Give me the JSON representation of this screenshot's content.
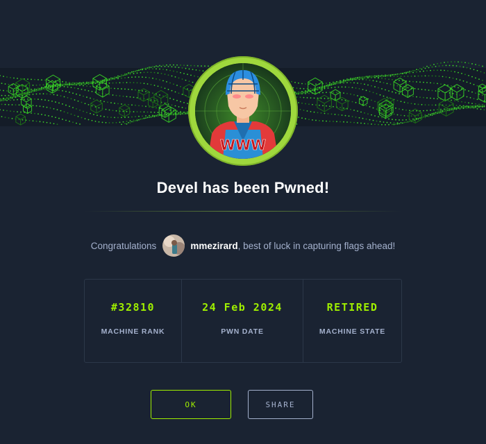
{
  "machine": {
    "name": "Devel",
    "pwned_title": "Devel has been Pwned!",
    "avatar_text": "WWW"
  },
  "message": {
    "prefix": "Congratulations",
    "username": "mmezirard",
    "suffix": ", best of luck in capturing flags ahead!"
  },
  "stats": [
    {
      "value": "#32810",
      "label": "MACHINE RANK"
    },
    {
      "value": "24 Feb 2024",
      "label": "PWN DATE"
    },
    {
      "value": "RETIRED",
      "label": "MACHINE STATE"
    }
  ],
  "buttons": {
    "ok_label": "OK",
    "share_label": "SHARE"
  },
  "colors": {
    "background": "#1a2332",
    "accent": "#9fef00",
    "ring": "#9fd83d",
    "muted_text": "#a4b1cd",
    "border": "#2c3849"
  },
  "icons": {
    "machine_avatar": "devel-machine-avatar",
    "user_avatar": "user-avatar",
    "banner": "green-cube-wave-banner"
  }
}
